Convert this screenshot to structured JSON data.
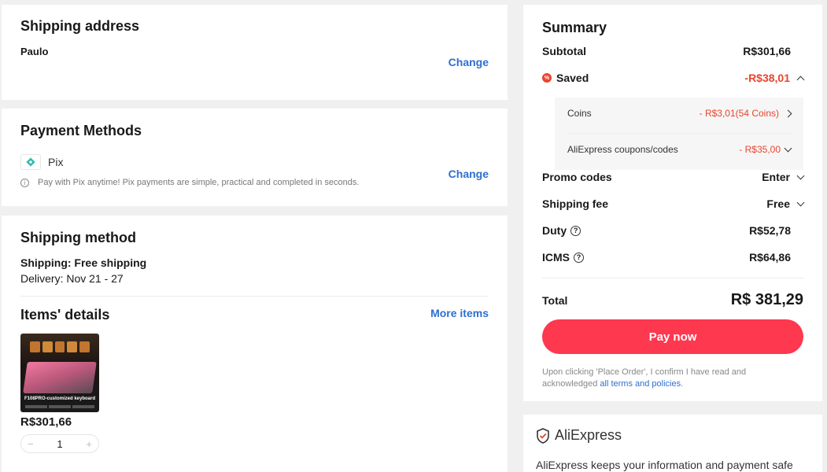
{
  "shipping_address": {
    "title": "Shipping address",
    "name": "Paulo",
    "change_label": "Change"
  },
  "payment": {
    "title": "Payment Methods",
    "method": "Pix",
    "note": "Pay with Pix anytime! Pix payments are simple, practical and completed in seconds.",
    "change_label": "Change"
  },
  "shipping_method": {
    "title": "Shipping method",
    "shipping": "Shipping: Free shipping",
    "delivery": "Delivery: Nov 21 - 27"
  },
  "items": {
    "title": "Items' details",
    "more_label": "More items",
    "product_caption": "F108PRO-customized keyboard",
    "price": "R$301,66",
    "quantity": "1",
    "minus": "−",
    "plus": "+"
  },
  "summary": {
    "title": "Summary",
    "subtotal_label": "Subtotal",
    "subtotal_value": "R$301,66",
    "saved_label": "Saved",
    "saved_value": "-R$38,01",
    "coins_label": "Coins",
    "coins_value": "- R$3,01(54 Coins)",
    "coupons_label": "AliExpress coupons/codes",
    "coupons_value": "- R$35,00",
    "promo_label": "Promo codes",
    "promo_value": "Enter",
    "shipping_label": "Shipping fee",
    "shipping_value": "Free",
    "duty_label": "Duty",
    "duty_value": "R$52,78",
    "icms_label": "ICMS",
    "icms_value": "R$64,86",
    "total_label": "Total",
    "total_value": "R$ 381,29",
    "pay_label": "Pay now",
    "disclaimer": "Upon clicking 'Place Order', I confirm I have read and acknowledged",
    "terms_link": "all terms and policies",
    "period": "."
  },
  "safety": {
    "brand": "AliExpress",
    "text": "AliExpress keeps your information and payment safe"
  },
  "colors": {
    "accent": "#fd384f",
    "link": "#2e6fd1",
    "saving": "#e9442f",
    "pix": "#32bcad"
  }
}
